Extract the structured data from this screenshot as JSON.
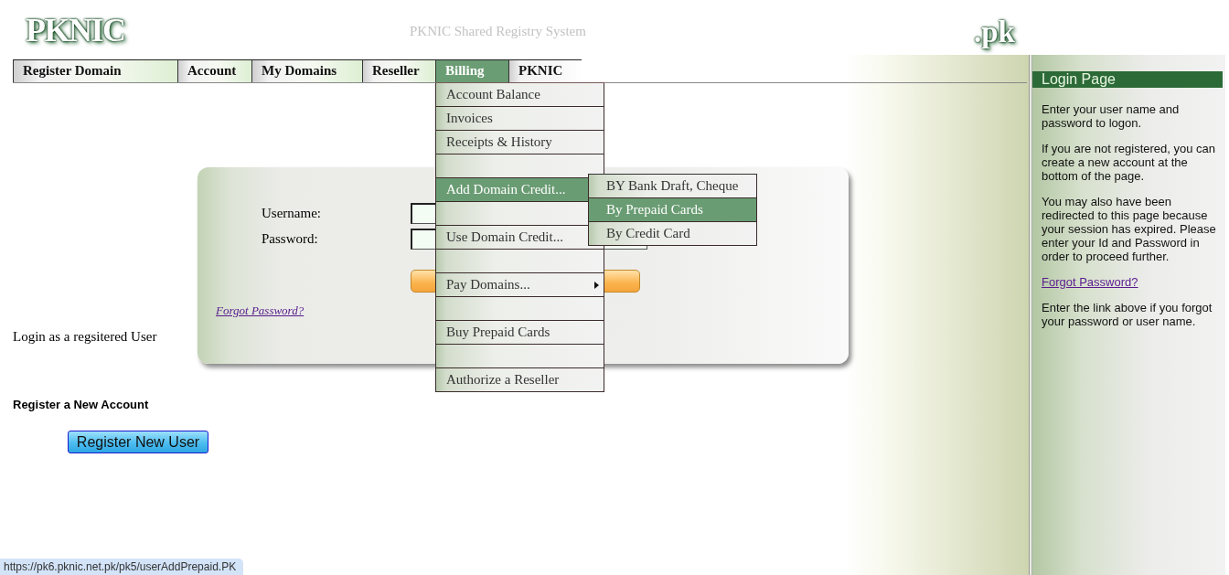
{
  "header": {
    "logo": "PKNIC",
    "title": "PKNIC Shared Registry System",
    "tld_logo": ".pk"
  },
  "nav": {
    "tabs": [
      {
        "label": "Register Domain",
        "selected": false
      },
      {
        "label": "Account",
        "selected": false
      },
      {
        "label": "My Domains",
        "selected": false
      },
      {
        "label": "Reseller",
        "selected": false
      },
      {
        "label": "Billing",
        "selected": true
      },
      {
        "label": "PKNIC",
        "selected": false
      }
    ]
  },
  "billing_menu": {
    "items": [
      {
        "kind": "item",
        "label": "Account Balance",
        "selected": false
      },
      {
        "kind": "item",
        "label": "Invoices",
        "selected": false
      },
      {
        "kind": "item",
        "label": "Receipts & History",
        "selected": false
      },
      {
        "kind": "blank",
        "selected": false
      },
      {
        "kind": "parent",
        "label": "Add Domain Credit...",
        "selected": true,
        "submenu": [
          {
            "label": "BY Bank Draft, Cheque",
            "selected": false
          },
          {
            "label": "By Prepaid Cards",
            "selected": true
          },
          {
            "label": "By Credit Card",
            "selected": false
          }
        ]
      },
      {
        "kind": "blank",
        "selected": false
      },
      {
        "kind": "item",
        "label": "Use Domain Credit...",
        "selected": false
      },
      {
        "kind": "blank",
        "selected": false
      },
      {
        "kind": "parent",
        "label": "Pay Domains...",
        "selected": false
      },
      {
        "kind": "blank",
        "selected": false
      },
      {
        "kind": "item",
        "label": "Buy Prepaid Cards",
        "selected": false
      },
      {
        "kind": "blank",
        "selected": false
      },
      {
        "kind": "item",
        "label": "Authorize a Reseller",
        "selected": false
      }
    ]
  },
  "login_caption": "Login as a regsitered User",
  "login_form": {
    "fields": [
      {
        "label": "Username:"
      },
      {
        "label": "Password:"
      }
    ],
    "forgot_link": "Forgot Password?"
  },
  "register": {
    "heading": "Register a New Account",
    "button": "Register New User"
  },
  "sidebar": {
    "title": "Login Page",
    "blocks": [
      {
        "kind": "text",
        "text": "Enter your user name and password to logon."
      },
      {
        "kind": "text",
        "text": "If you are not registered, you can create a new account at the bottom of the page."
      },
      {
        "kind": "text",
        "text": "You may also have been redirected to this page because your session has expired. Please enter your Id and Password in order to proceed further."
      },
      {
        "kind": "link",
        "text": "Forgot Password?"
      },
      {
        "kind": "text",
        "text": "Enter the link above if you forgot your password or user name."
      }
    ]
  },
  "status_bar": {
    "url": "https://pk6.pknic.net.pk/pk5/userAddPrepaid.PK"
  }
}
